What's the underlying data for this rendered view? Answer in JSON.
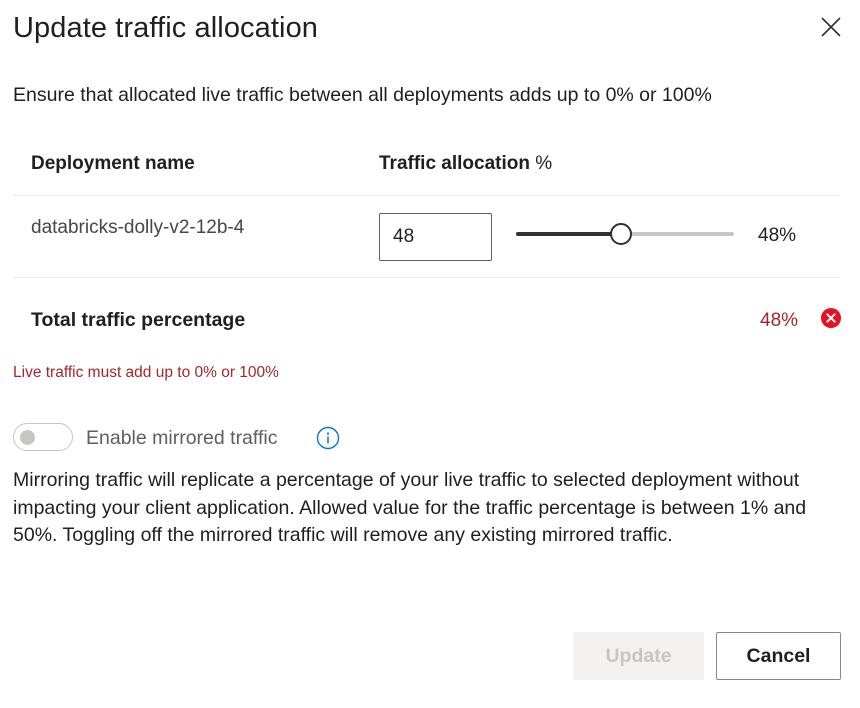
{
  "dialog": {
    "title": "Update traffic allocation",
    "description": "Ensure that allocated live traffic between all deployments adds up to 0% or 100%"
  },
  "table": {
    "headers": {
      "deployment_name": "Deployment name",
      "traffic_allocation_bold": "Traffic allocation",
      "traffic_allocation_unit": " %"
    },
    "rows": [
      {
        "deployment_name": "databricks-dolly-v2-12b-4",
        "input_value": "48",
        "slider_value": 48,
        "slider_max": 100,
        "percent_label": "48%"
      }
    ]
  },
  "total": {
    "label": "Total traffic percentage",
    "value": "48%",
    "error_message": "Live traffic must add up to 0% or 100%"
  },
  "mirror": {
    "toggle_label": "Enable mirrored traffic",
    "toggle_on": false,
    "description": "Mirroring traffic will replicate a percentage of your live traffic to selected deployment without impacting your client application. Allowed value for the traffic percentage is between 1% and 50%. Toggling off the mirrored traffic will remove any existing mirrored traffic."
  },
  "buttons": {
    "update": "Update",
    "cancel": "Cancel"
  },
  "icons": {
    "close": "close-icon",
    "error": "error-circle-icon",
    "info": "info-icon"
  },
  "colors": {
    "error": "#a4262c",
    "accent": "#0078d4",
    "slider": "#323130"
  }
}
